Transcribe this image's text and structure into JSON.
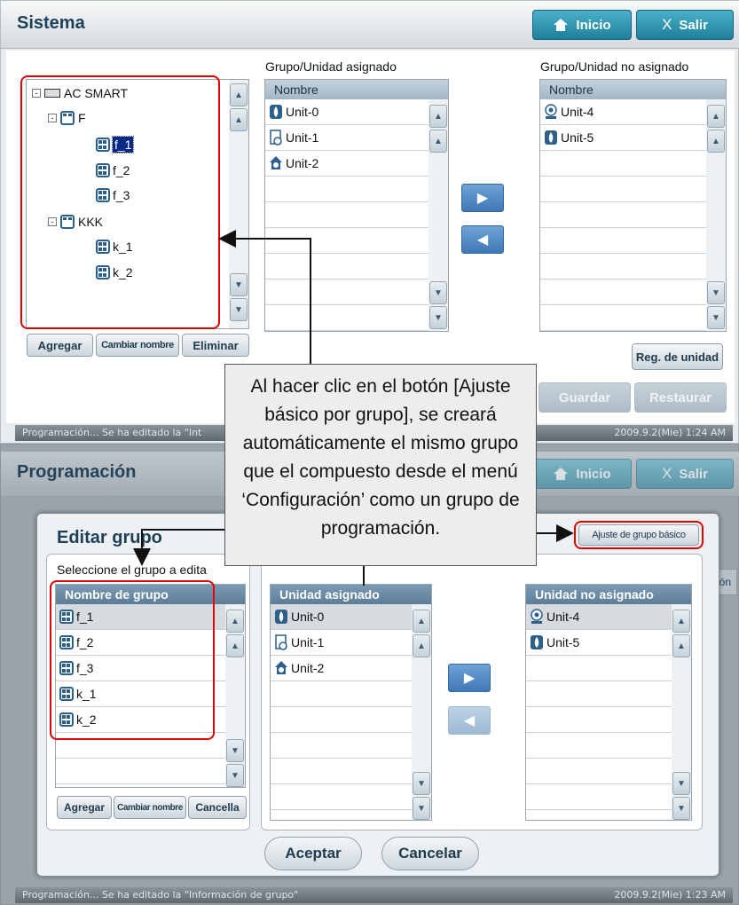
{
  "top": {
    "title": "Sistema",
    "home_label": "Inicio",
    "exit_label": "Salir",
    "tree": {
      "root": "AC SMART",
      "groups": [
        {
          "name": "F",
          "items": [
            "f_1",
            "f_2",
            "f_3"
          ]
        },
        {
          "name": "KKK",
          "items": [
            "k_1",
            "k_2"
          ]
        }
      ]
    },
    "buttons": {
      "add": "Agregar",
      "rename": "Cambiar nombre",
      "delete": "Eliminar",
      "reg_unit": "Reg. de unidad",
      "save": "Guardar",
      "restore": "Restaurar"
    },
    "assigned": {
      "title": "Grupo/Unidad asignado",
      "header": "Nombre",
      "rows": [
        "Unit-0",
        "Unit-1",
        "Unit-2"
      ]
    },
    "unassigned": {
      "title": "Grupo/Unidad no asignado",
      "header": "Nombre",
      "rows": [
        "Unit-4",
        "Unit-5"
      ]
    },
    "status": {
      "text": "Programación... Se ha editado la \"Int",
      "time": "2009.9.2(Mie) 1:24 AM"
    }
  },
  "bottom": {
    "app_title": "Programación",
    "home_label": "Inicio",
    "exit_label": "Salir",
    "dialog": {
      "title": "Editar grupo",
      "basic_button": "Ajuste de grupo básico",
      "select_label": "Seleccione el grupo a edita",
      "groups_header": "Nombre de grupo",
      "groups": [
        "f_1",
        "f_2",
        "f_3",
        "k_1",
        "k_2"
      ],
      "assigned_header": "Unidad asignado",
      "assigned": [
        "Unit-0",
        "Unit-1",
        "Unit-2"
      ],
      "unassigned_header": "Unidad no asignado",
      "unassigned": [
        "Unit-4",
        "Unit-5"
      ],
      "buttons": {
        "add": "Agregar",
        "rename": "Cambiar nombre",
        "cancel_small": "Cancella",
        "accept": "Aceptar",
        "cancel": "Cancelar"
      }
    },
    "side_fragment": "ión",
    "status": {
      "text": "Programación... Se ha editado la \"Información de grupo\"",
      "time": "2009.9.2(Mie) 1:23 AM"
    }
  },
  "callout": {
    "text": "Al hacer clic en el botón [Ajuste básico por grupo], se creará automáticamente el mismo grupo que el compuesto desde el menú ‘Configuración’ como un grupo de programación."
  },
  "colors": {
    "accent": "#1f7f9a",
    "highlight": "#e00000",
    "selection": "#0a2a8a"
  }
}
